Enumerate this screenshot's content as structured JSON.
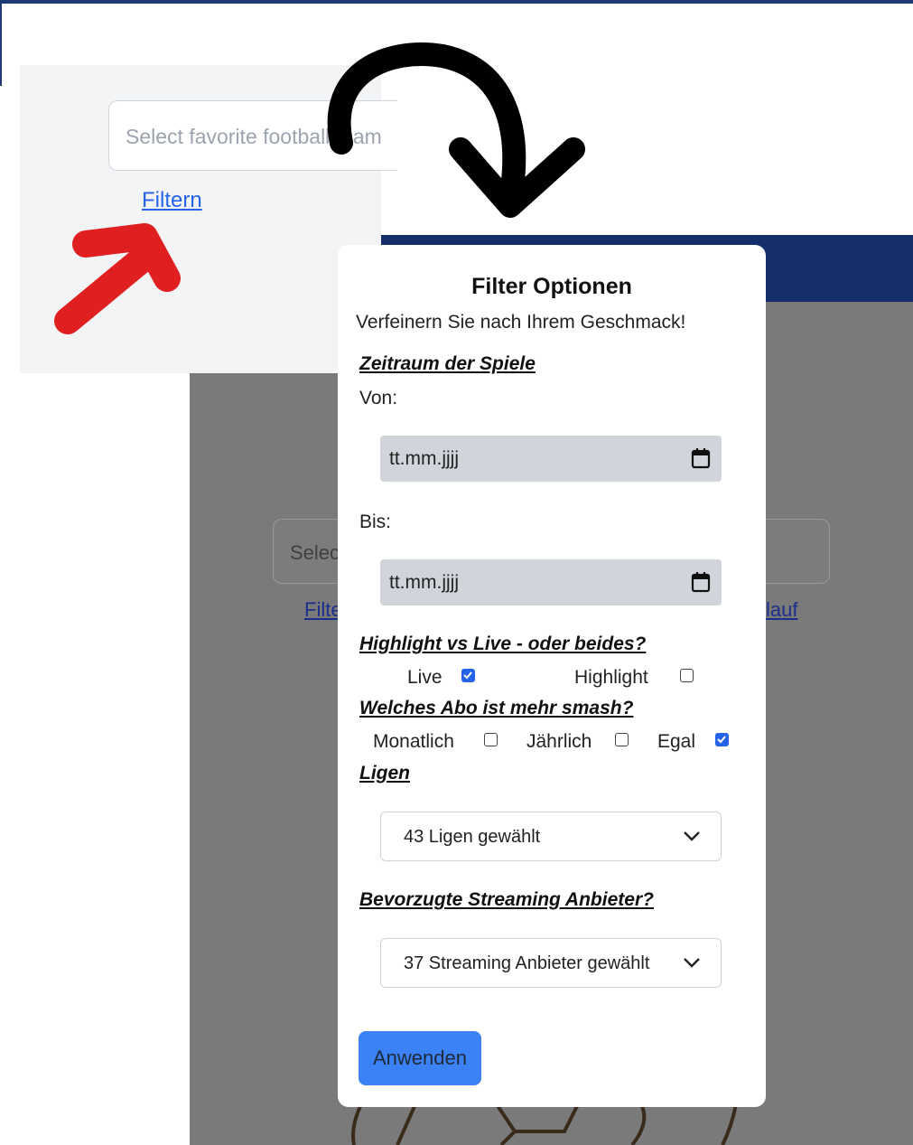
{
  "background": {
    "search_placeholder": "Selec",
    "link_left": "Filte",
    "link_right": "lauf"
  },
  "inset": {
    "search_placeholder": "Select favorite football team",
    "filter_link": "Filtern"
  },
  "modal": {
    "title": "Filter Optionen",
    "subtitle": "Verfeinern Sie nach Ihrem Geschmack!",
    "date_section": {
      "heading": "Zeitraum der Spiele",
      "from_label": "Von:",
      "to_label": "Bis:",
      "date_placeholder": "tt.mm.jjjj"
    },
    "type_section": {
      "heading": "Highlight vs Live - oder beides?",
      "options": [
        {
          "label": "Live",
          "checked": true
        },
        {
          "label": "Highlight",
          "checked": false
        }
      ]
    },
    "abo_section": {
      "heading": "Welches Abo ist mehr smash?",
      "options": [
        {
          "label": "Monatlich",
          "checked": false
        },
        {
          "label": "Jährlich",
          "checked": false
        },
        {
          "label": "Egal",
          "checked": true
        }
      ]
    },
    "leagues_section": {
      "heading": "Ligen",
      "selected": "43 Ligen gewählt"
    },
    "streaming_section": {
      "heading": "Bevorzugte Streaming Anbieter?",
      "selected": "37 Streaming Anbieter gewählt"
    },
    "apply_label": "Anwenden"
  },
  "colors": {
    "header_blue": "#142f6b",
    "accent_blue": "#3b82f6",
    "checkbox_blue": "#2563eb",
    "annotation_red": "#e02020",
    "annotation_black": "#000000"
  }
}
